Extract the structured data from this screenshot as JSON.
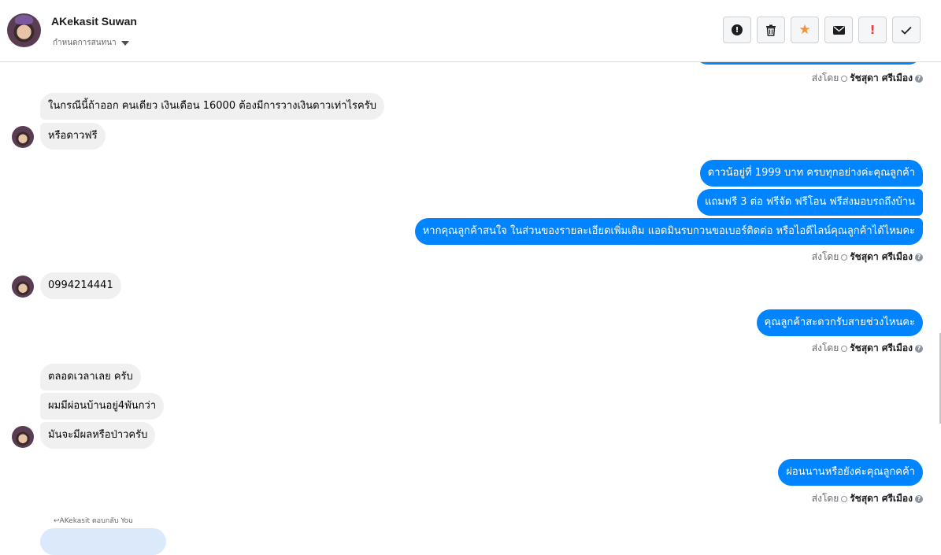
{
  "header": {
    "contact_name": "AKekasit Suwan",
    "subtitle": "กำหนดการสนทนา",
    "actions": [
      {
        "icon": "info-circle-icon"
      },
      {
        "icon": "trash-icon"
      },
      {
        "icon": "star-icon",
        "color": "#f7923b"
      },
      {
        "icon": "mail-icon"
      },
      {
        "icon": "priority-flag-icon",
        "color": "#fa383e"
      },
      {
        "icon": "check-icon"
      }
    ]
  },
  "conversation": {
    "sender_prefix": "ส่งโดย",
    "sender_name": "รัชสุดา ศรีเมือง",
    "messages": {
      "in_1": "ในกรณีนี้ถ้าออก คนเดียว เงินเดือน 16000 ต้องมีการวางเงินดาวเท่าไรครับ",
      "in_2": "หรือดาวฟรี",
      "out_1": "ดาวน้อยู่ที่  1999 บาท  ครบทุกอย่างค่ะคุณลูกค้า",
      "out_2": "แถมฟรี 3 ต่อ ฟรีจัด ฟรีโอน  ฟรีส่งมอบรถถึงบ้าน",
      "out_3": "หากคุณลูกค้าสนใจ ในส่วนของรายละเอียดเพิ่มเติม แอดมินรบกวนขอเบอร์ติดต่อ หรือไอดีไลน์คุณลูกค้าได้ไหมคะ",
      "in_3": "0994214441",
      "out_4": "คุณลูกค้าสะดวกรับสายช่วงไหนคะ",
      "in_4": "ตลอดเวลาเลย ครับ",
      "in_5": "ผมมีผ่อนบ้านอยู่4พันกว่า",
      "in_6": "มันจะมีผลหรือป่าวครับ",
      "out_5": "ผ่อนนานหรือยังค่ะคุณลูกคค้า"
    },
    "reply_label": "AKekasit ตอบกลับ You"
  },
  "colors": {
    "outgoing_bubble": "#0084ff",
    "incoming_bubble": "#f0f0f0",
    "quoted_bubble": "#dbe9fb"
  }
}
